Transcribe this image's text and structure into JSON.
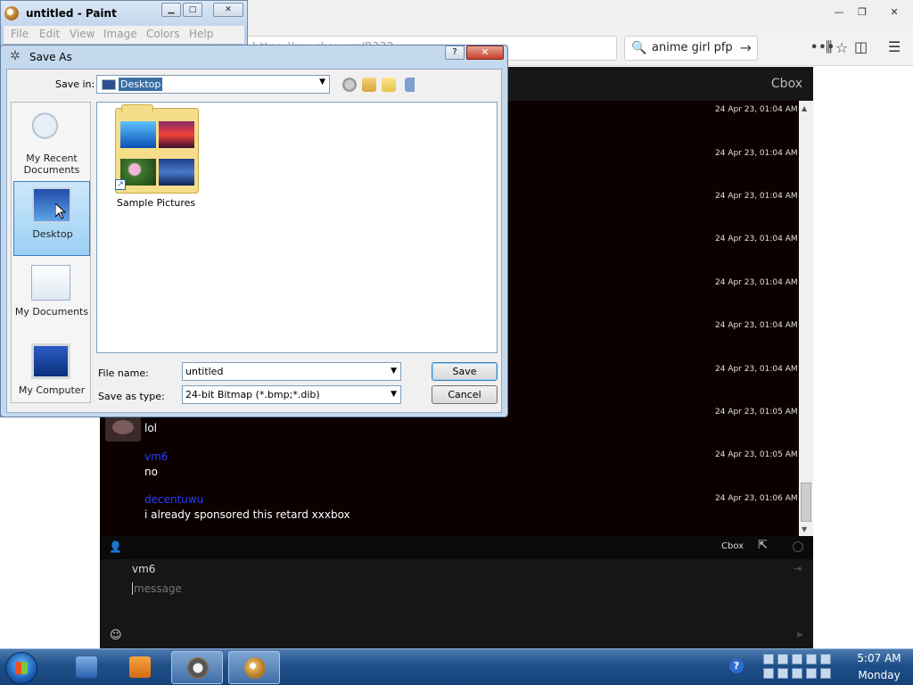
{
  "browser": {
    "url": "https://my.cbox.ws/8332",
    "search_query": "anime girl pfp",
    "more_label": "•••",
    "star_icon": "☆",
    "search_icon": "🔍",
    "go_icon": "→"
  },
  "cbox": {
    "header_title": "Cbox",
    "messages": [
      {
        "time": "24 Apr 23, 01:04 AM"
      },
      {
        "time": "24 Apr 23, 01:04 AM"
      },
      {
        "time": "24 Apr 23, 01:04 AM"
      },
      {
        "time": "24 Apr 23, 01:04 AM"
      },
      {
        "time": "24 Apr 23, 01:04 AM"
      },
      {
        "time": "24 Apr 23, 01:04 AM"
      },
      {
        "time": "24 Apr 23, 01:04 AM"
      },
      {
        "time": "24 Apr 23, 01:05 AM",
        "user": "...",
        "text": "lol"
      },
      {
        "time": "24 Apr 23, 01:05 AM",
        "user": "vm6",
        "text": "no"
      },
      {
        "time": "24 Apr 23, 01:06 AM",
        "user": "decentuwu",
        "text": "i already sponsored this retard xxxbox"
      }
    ],
    "bar_link": "Cbox",
    "input_name": "vm6",
    "message_placeholder": "message"
  },
  "paint": {
    "title": "untitled - Paint",
    "menu": [
      "File",
      "Edit",
      "View",
      "Image",
      "Colors",
      "Help"
    ]
  },
  "save_dialog": {
    "title": "Save As",
    "save_in_label": "Save in:",
    "save_in_value": "Desktop",
    "places": [
      {
        "label": "My Recent Documents"
      },
      {
        "label": "Desktop",
        "selected": true
      },
      {
        "label": "My Documents"
      },
      {
        "label": "My Computer"
      }
    ],
    "files": [
      {
        "name": "Sample Pictures"
      }
    ],
    "file_name_label": "File name:",
    "file_name_value": "untitled",
    "save_type_label": "Save as type:",
    "save_type_value": "24-bit Bitmap (*.bmp;*.dib)",
    "save_button": "Save",
    "cancel_button": "Cancel"
  },
  "taskbar": {
    "clock_time": "5:07 AM",
    "clock_day": "Monday",
    "help_icon": "?"
  }
}
